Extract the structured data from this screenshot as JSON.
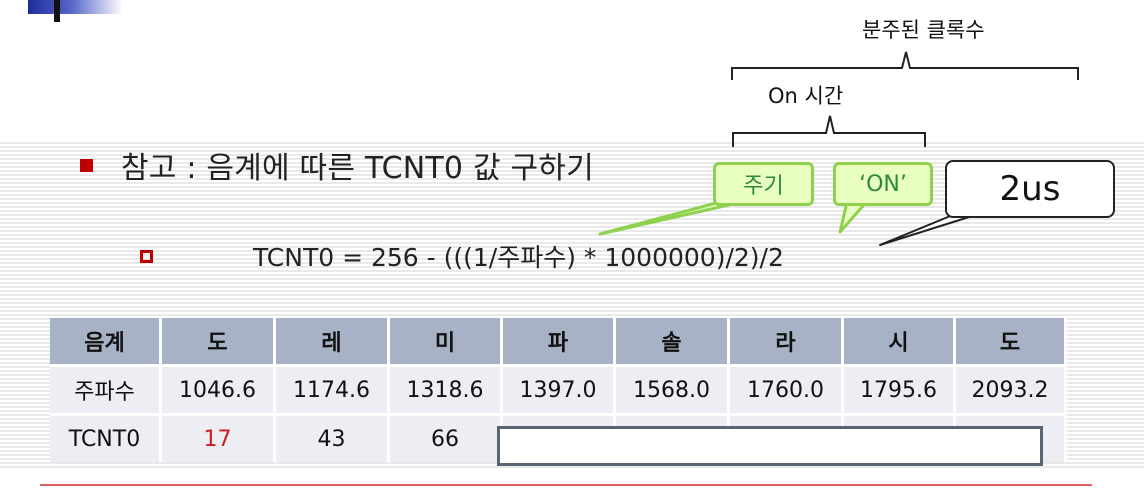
{
  "annotations": {
    "top_brace_label": "분주된 클록수",
    "on_time_label": "On 시간"
  },
  "heading": {
    "text": "참고 : 음계에 따른 TCNT0 값 구하기"
  },
  "formula": {
    "text": "TCNT0 = 256 - (((1/주파수) * 1000000)/2)/2"
  },
  "callouts": {
    "period": "주기",
    "on": "‘ON’",
    "duration": "2us"
  },
  "table": {
    "header": [
      "음계",
      "도",
      "레",
      "미",
      "파",
      "솔",
      "라",
      "시",
      "도"
    ],
    "rows": [
      [
        "주파수",
        "1046.6",
        "1174.6",
        "1318.6",
        "1397.0",
        "1568.0",
        "1760.0",
        "1795.6",
        "2093.2"
      ],
      [
        "TCNT0",
        "17",
        "43",
        "66"
      ]
    ]
  },
  "colors": {
    "bullet": "#c00000",
    "callout_fill": "#e8ffbf",
    "callout_border": "#8fd14f",
    "header_fill": "#a8b2c6",
    "cell_fill": "#eceef3",
    "highlight_value": "#cc2020"
  }
}
